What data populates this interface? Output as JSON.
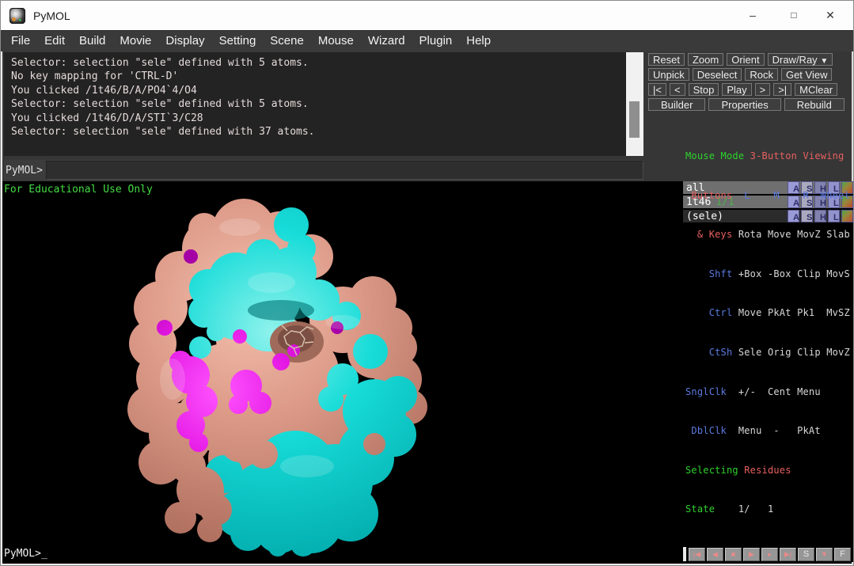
{
  "window": {
    "title": "PyMOL",
    "minimize": "–",
    "maximize": "□",
    "close": "✕"
  },
  "menu": {
    "items": [
      "File",
      "Edit",
      "Build",
      "Movie",
      "Display",
      "Setting",
      "Scene",
      "Mouse",
      "Wizard",
      "Plugin",
      "Help"
    ]
  },
  "console": {
    "lines": [
      "Selector: selection \"sele\" defined with 5 atoms.",
      "No key mapping for 'CTRL-D'",
      "You clicked /1t46/B/A/PO4`4/O4",
      "Selector: selection \"sele\" defined with 5 atoms.",
      "You clicked /1t46/D/A/STI`3/C28",
      "Selector: selection \"sele\" defined with 37 atoms."
    ]
  },
  "controls": {
    "reset": "Reset",
    "zoom": "Zoom",
    "orient": "Orient",
    "draw_ray": "Draw/Ray",
    "draw_ray_arrow": "▼",
    "unpick": "Unpick",
    "deselect": "Deselect",
    "rock": "Rock",
    "get_view": "Get View",
    "first": "|<",
    "prev": "<",
    "stop": "Stop",
    "play": "Play",
    "next": ">",
    "last": ">|",
    "mclear": "MClear",
    "builder": "Builder",
    "properties": "Properties",
    "rebuild": "Rebuild"
  },
  "command": {
    "prompt": "PyMOL>",
    "value": ""
  },
  "viewport": {
    "watermark": "For Educational Use Only",
    "prompt": "PyMOL>_"
  },
  "object_buttons": {
    "a": "A",
    "s": "S",
    "h": "H",
    "l": "L"
  },
  "objects": [
    {
      "label": "all",
      "state": ""
    },
    {
      "label": "1t46",
      "state": "1/1"
    },
    {
      "label": "(sele)",
      "state": ""
    }
  ],
  "mouse_panel": {
    "rows": [
      {
        "label": "Mouse Mode",
        "lc": "green",
        "text": " 3-Button Viewing",
        "tc": "salmon"
      },
      {
        "label": " Buttons",
        "lc": "salmon",
        "text": "  L    M    R  Wheel",
        "tc": "blue"
      },
      {
        "label": "  & Keys",
        "lc": "salmon",
        "text": " Rota Move MovZ Slab",
        "tc": "white"
      },
      {
        "label": "    Shft",
        "lc": "blue",
        "text": " +Box -Box Clip MovS",
        "tc": "white"
      },
      {
        "label": "    Ctrl",
        "lc": "blue",
        "text": " Move PkAt Pk1  MvSZ",
        "tc": "white"
      },
      {
        "label": "    CtSh",
        "lc": "blue",
        "text": " Sele Orig Clip MovZ",
        "tc": "white"
      },
      {
        "label": "SnglClk",
        "lc": "blue",
        "text": "  +/-  Cent Menu",
        "tc": "white"
      },
      {
        "label": " DblClk",
        "lc": "blue",
        "text": "  Menu  -   PkAt",
        "tc": "white"
      },
      {
        "label": "Selecting",
        "lc": "green",
        "text": " Residues",
        "tc": "salmon"
      },
      {
        "label": "State",
        "lc": "green",
        "text": "    1/   1",
        "tc": "white"
      }
    ]
  },
  "playback": {
    "first": "|◀",
    "prev": "◀",
    "stop": "■",
    "play": "▶",
    "next": "▸",
    "last": "▶|",
    "s": "S",
    "down": "▼",
    "f": "F"
  },
  "colors": {
    "cyan": "#00d8d4",
    "salmon": "#dd9a88",
    "magenta": "#e316e3",
    "watermark_green": "#44dc44"
  }
}
